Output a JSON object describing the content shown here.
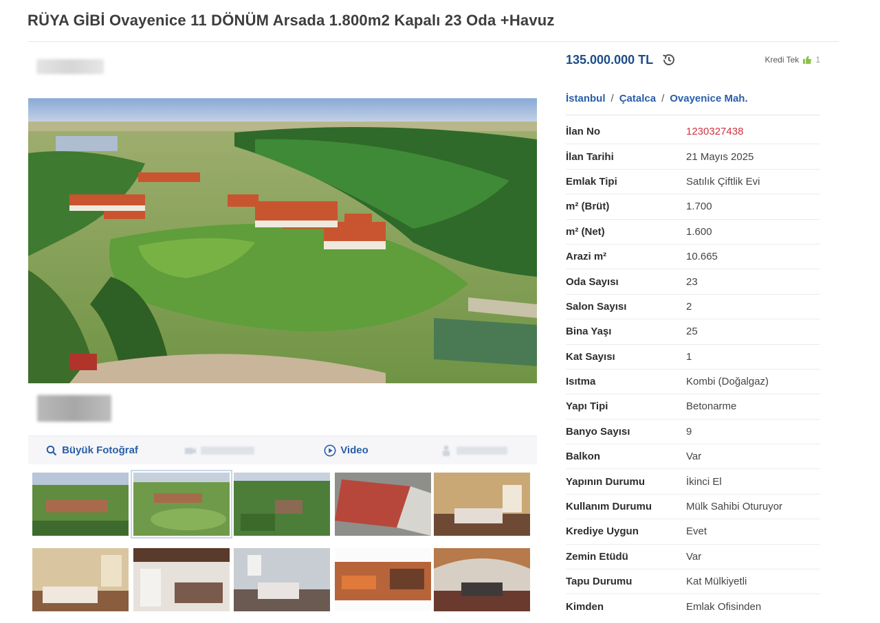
{
  "listing": {
    "title": "RÜYA GİBİ Ovayenice 11 DÖNÜM Arsada 1.800m2 Kapalı 23 Oda +Havuz"
  },
  "price": {
    "value": "135.000.000 TL",
    "history_icon": "history-icon",
    "credit_label": "Kredi Tek",
    "credit_icon": "thumbs-up-icon",
    "credit_count": "1"
  },
  "breadcrumb": {
    "items": [
      "İstanbul",
      "Çatalca",
      "Ovayenice Mah."
    ],
    "separator": "/"
  },
  "details": [
    {
      "label": "İlan No",
      "value": "1230327438"
    },
    {
      "label": "İlan Tarihi",
      "value": "21 Mayıs 2025"
    },
    {
      "label": "Emlak Tipi",
      "value": "Satılık Çiftlik Evi"
    },
    {
      "label": "m² (Brüt)",
      "value": "1.700"
    },
    {
      "label": "m² (Net)",
      "value": "1.600"
    },
    {
      "label": "Arazi m²",
      "value": "10.665"
    },
    {
      "label": "Oda Sayısı",
      "value": "23"
    },
    {
      "label": "Salon Sayısı",
      "value": "2"
    },
    {
      "label": "Bina Yaşı",
      "value": "25"
    },
    {
      "label": "Kat Sayısı",
      "value": "1"
    },
    {
      "label": "Isıtma",
      "value": "Kombi (Doğalgaz)"
    },
    {
      "label": "Yapı Tipi",
      "value": "Betonarme"
    },
    {
      "label": "Banyo Sayısı",
      "value": "9"
    },
    {
      "label": "Balkon",
      "value": "Var"
    },
    {
      "label": "Yapının Durumu",
      "value": "İkinci El"
    },
    {
      "label": "Kullanım Durumu",
      "value": "Mülk Sahibi Oturuyor"
    },
    {
      "label": "Krediye Uygun",
      "value": "Evet"
    },
    {
      "label": "Zemin Etüdü",
      "value": "Var"
    },
    {
      "label": "Tapu Durumu",
      "value": "Kat Mülkiyetli"
    },
    {
      "label": "Kimden",
      "value": "Emlak Ofisinden"
    }
  ],
  "toolbar": {
    "large_photo": "Büyük Fotoğraf",
    "video": "Video",
    "large_photo_icon": "magnifier-icon",
    "video_icon": "play-circle-icon",
    "map_icon": "camera-icon",
    "tour_icon": "tour-icon"
  },
  "colors": {
    "link_blue": "#2a5ea8",
    "price_blue": "#1d4c8a",
    "listing_no_red": "#d1333f",
    "credit_green": "#8bc34a"
  }
}
